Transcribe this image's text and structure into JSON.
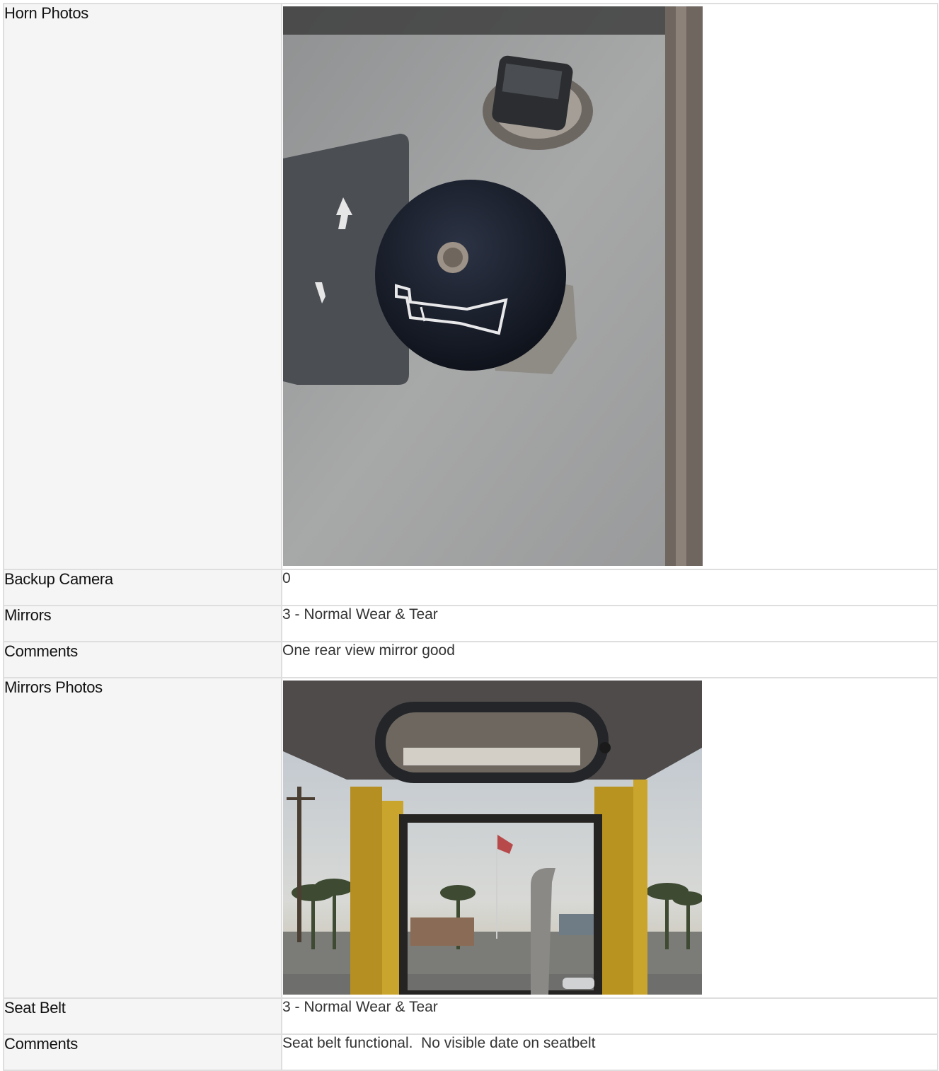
{
  "rows": [
    {
      "label": "Horn Photos",
      "type": "photo",
      "photo": "horn-button-photo"
    },
    {
      "label": "Backup Camera",
      "type": "text",
      "value": "0"
    },
    {
      "label": "Mirrors",
      "type": "text",
      "value": "3 - Normal Wear & Tear"
    },
    {
      "label": "Comments",
      "type": "text",
      "value": "One rear view mirror good"
    },
    {
      "label": "Mirrors Photos",
      "type": "photo",
      "photo": "rear-view-mirror-photo"
    },
    {
      "label": "Seat Belt",
      "type": "text",
      "value": "3 - Normal Wear & Tear"
    },
    {
      "label": "Comments",
      "type": "text",
      "value": "Seat belt functional.  No visible date on seatbelt"
    }
  ],
  "colors": {
    "label_bg": "#f5f5f5",
    "border": "#dedede",
    "cab_yellow": "#c9a227"
  }
}
